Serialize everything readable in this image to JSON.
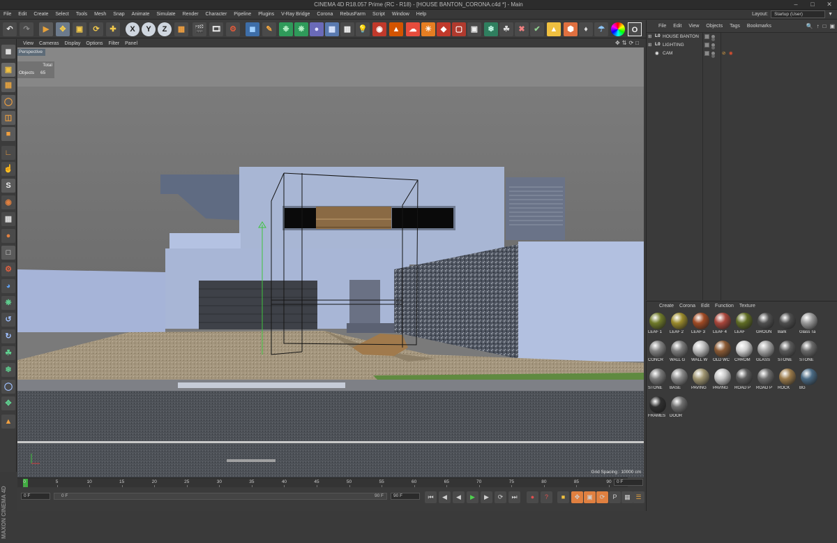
{
  "window": {
    "title": "CINEMA 4D R18.057 Prime (RC - R18) - [HOUSE BANTON_CORONA.c4d *] - Main"
  },
  "menubar": {
    "items": [
      "File",
      "Edit",
      "Create",
      "Select",
      "Tools",
      "Mesh",
      "Snap",
      "Animate",
      "Simulate",
      "Render",
      "Character",
      "Pipeline",
      "Plugins",
      "V-Ray Bridge",
      "Corona",
      "RebusFarm",
      "Script",
      "Window",
      "Help"
    ],
    "layout_label": "Layout:",
    "layout_value": "Startup (User)"
  },
  "toolbar": {
    "axis_buttons": [
      "X",
      "Y",
      "Z"
    ]
  },
  "viewport": {
    "menu": [
      "View",
      "Cameras",
      "Display",
      "Options",
      "Filter",
      "Panel"
    ],
    "camera_label": "Perspective",
    "hud_total": "Total",
    "hud_objects_label": "Objects",
    "hud_objects_value": "65",
    "grid_spacing": "Grid Spacing : 10000 cm"
  },
  "timeline": {
    "ticks": [
      "0",
      "5",
      "10",
      "15",
      "20",
      "25",
      "30",
      "35",
      "40",
      "45",
      "50",
      "55",
      "60",
      "65",
      "70",
      "75",
      "80",
      "85",
      "90"
    ],
    "end_frame": "0 F"
  },
  "transport": {
    "start_field": "0 F",
    "range_start": "0 F",
    "range_end": "90 F",
    "end_field": "90 F"
  },
  "object_manager": {
    "menu": [
      "File",
      "Edit",
      "View",
      "Objects",
      "Tags",
      "Bookmarks"
    ],
    "objects": [
      {
        "name": "HOUSE BANTON"
      },
      {
        "name": "LIGHTING"
      },
      {
        "name": "CAM"
      }
    ]
  },
  "material_manager": {
    "menu": [
      "Create",
      "Corona",
      "Edit",
      "Function",
      "Texture"
    ],
    "materials": [
      {
        "name": "LEAF 1",
        "color": "#6f7a2a"
      },
      {
        "name": "LEAF 2",
        "color": "#9a8a2c"
      },
      {
        "name": "LEAF 3",
        "color": "#a04a24"
      },
      {
        "name": "LEAF 4",
        "color": "#a8453a"
      },
      {
        "name": "LEAF",
        "color": "#5f6c24"
      },
      {
        "name": "GROUN",
        "color": "#4f4f4f"
      },
      {
        "name": "Bark",
        "color": "#4d4d4d"
      },
      {
        "name": "Glass Ta",
        "color": "#9a9a9a"
      },
      {
        "name": "CONCR",
        "color": "#828282"
      },
      {
        "name": "WALL G",
        "color": "#7d7d7d"
      },
      {
        "name": "WALL W",
        "color": "#bdbdbd"
      },
      {
        "name": "OLD WC",
        "color": "#8a5a34"
      },
      {
        "name": "CHROM",
        "color": "#d0d0d0"
      },
      {
        "name": "GLASS",
        "color": "#a5a5a5"
      },
      {
        "name": "STONE",
        "color": "#5a5a5a"
      },
      {
        "name": "STONE",
        "color": "#6a6a6a"
      },
      {
        "name": "STONE",
        "color": "#7a7a7a"
      },
      {
        "name": "BASE",
        "color": "#8a8a8a"
      },
      {
        "name": "PAVING",
        "color": "#a09672"
      },
      {
        "name": "PAVING",
        "color": "#c6c6c6"
      },
      {
        "name": "ROAD P",
        "color": "#5a5a5a"
      },
      {
        "name": "ROAD P",
        "color": "#6c6c6c"
      },
      {
        "name": "ROCK",
        "color": "#9a7a4a"
      },
      {
        "name": "BG",
        "color": "#4a6a84"
      },
      {
        "name": "FRAMES",
        "color": "#2f2f2f"
      },
      {
        "name": "DOOR",
        "color": "#6f6f6f"
      }
    ]
  }
}
